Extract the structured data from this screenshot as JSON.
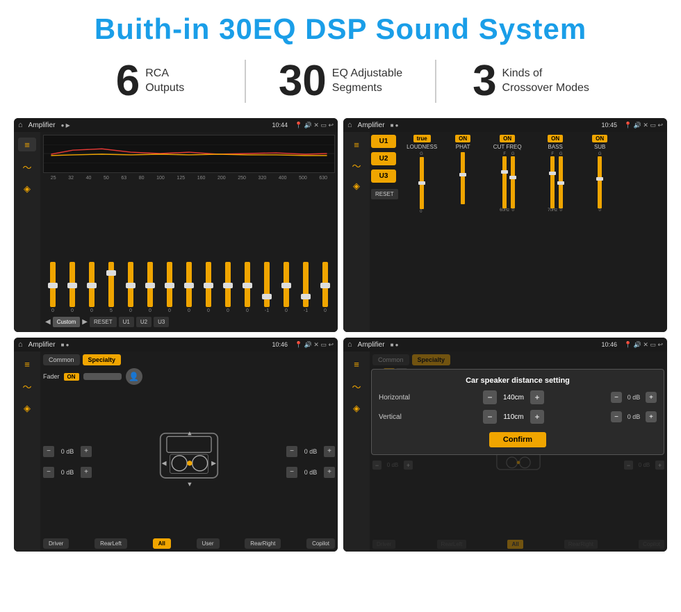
{
  "header": {
    "title": "Buith-in 30EQ DSP Sound System"
  },
  "stats": [
    {
      "number": "6",
      "label_line1": "RCA",
      "label_line2": "Outputs"
    },
    {
      "number": "30",
      "label_line1": "EQ Adjustable",
      "label_line2": "Segments"
    },
    {
      "number": "3",
      "label_line1": "Kinds of",
      "label_line2": "Crossover Modes"
    }
  ],
  "screens": [
    {
      "id": "screen1",
      "status": {
        "app": "Amplifier",
        "time": "10:44"
      },
      "eq": {
        "frequencies": [
          "25",
          "32",
          "40",
          "50",
          "63",
          "80",
          "100",
          "125",
          "160",
          "200",
          "250",
          "320",
          "400",
          "500",
          "630"
        ],
        "values": [
          "0",
          "0",
          "0",
          "5",
          "0",
          "0",
          "0",
          "0",
          "0",
          "0",
          "0",
          "-1",
          "0",
          "-1"
        ],
        "buttons": [
          "Custom",
          "RESET",
          "U1",
          "U2",
          "U3"
        ]
      }
    },
    {
      "id": "screen2",
      "status": {
        "app": "Amplifier",
        "time": "10:45"
      },
      "channels": [
        {
          "name": "LOUDNESS",
          "on": true
        },
        {
          "name": "PHAT",
          "on": true
        },
        {
          "name": "CUT FREQ",
          "on": true
        },
        {
          "name": "BASS",
          "on": true
        },
        {
          "name": "SUB",
          "on": true
        }
      ],
      "u_buttons": [
        "U1",
        "U2",
        "U3"
      ],
      "reset": "RESET"
    },
    {
      "id": "screen3",
      "status": {
        "app": "Amplifier",
        "time": "10:46"
      },
      "tabs": [
        "Common",
        "Specialty"
      ],
      "active_tab": "Specialty",
      "fader": {
        "label": "Fader",
        "on": "ON"
      },
      "db_rows": [
        {
          "value": "0 dB"
        },
        {
          "value": "0 dB"
        },
        {
          "value": "0 dB"
        },
        {
          "value": "0 dB"
        }
      ],
      "bottom_buttons": [
        "Driver",
        "RearLeft",
        "All",
        "User",
        "RearRight",
        "Copilot"
      ]
    },
    {
      "id": "screen4",
      "status": {
        "app": "Amplifier",
        "time": "10:46"
      },
      "dialog": {
        "title": "Car speaker distance setting",
        "horizontal_label": "Horizontal",
        "horizontal_value": "140cm",
        "vertical_label": "Vertical",
        "vertical_value": "110cm",
        "confirm": "Confirm"
      },
      "bottom_buttons": [
        "Driver",
        "RearLeft",
        "All",
        "User",
        "RearRight",
        "Copilot"
      ]
    }
  ]
}
